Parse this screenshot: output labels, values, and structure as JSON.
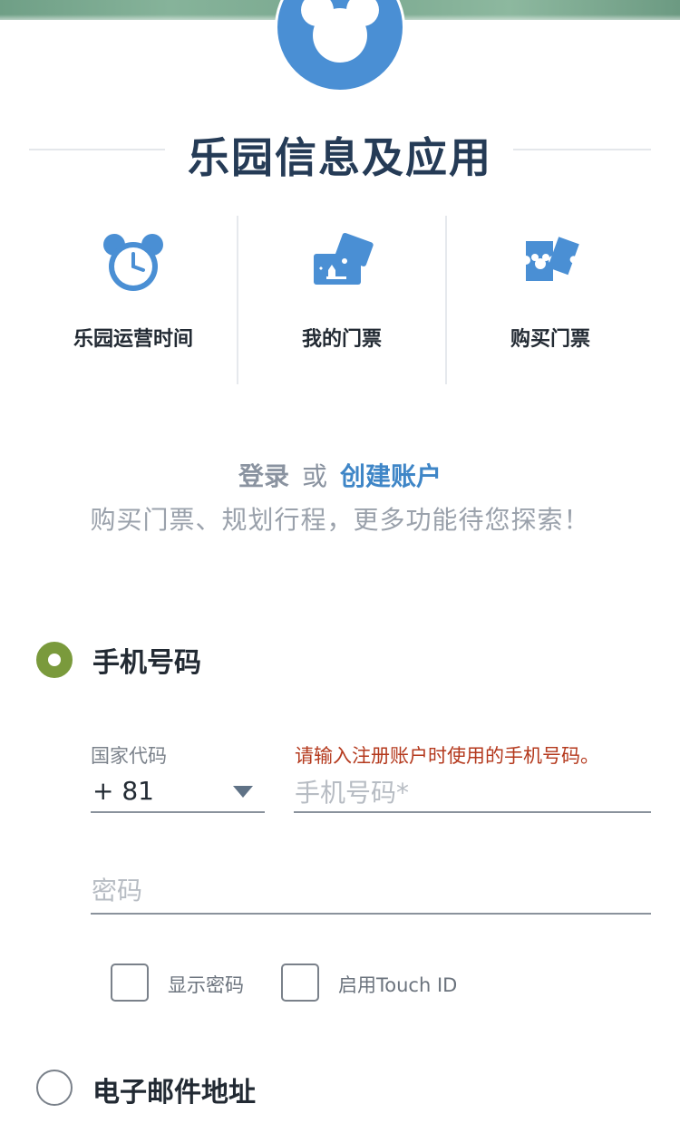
{
  "header": {
    "title": "乐园信息及应用"
  },
  "quick_links": [
    {
      "label": "乐园运营时间",
      "icon": "mickey-clock-icon"
    },
    {
      "label": "我的门票",
      "icon": "my-tickets-icon"
    },
    {
      "label": "购买门票",
      "icon": "buy-tickets-icon"
    }
  ],
  "login_prompt": {
    "login": "登录",
    "or": "或",
    "create_account": "创建账户",
    "promo": "购买门票、规划行程，更多功能待您探索！"
  },
  "form": {
    "phone_option_label": "手机号码",
    "country_code_caption": "国家代码",
    "country_code_value": "+ 81",
    "phone_error": "请输入注册账户时使用的手机号码。",
    "phone_placeholder": "手机号码*",
    "password_placeholder": "密码",
    "show_password_label": "显示密码",
    "touch_id_label": "启用Touch ID",
    "email_option_label": "电子邮件地址"
  },
  "colors": {
    "accent_blue": "#4a8fd4",
    "link_blue": "#3f86c7",
    "radio_green": "#7a9a3c",
    "error_red": "#b4391d",
    "title_navy": "#253b56"
  }
}
